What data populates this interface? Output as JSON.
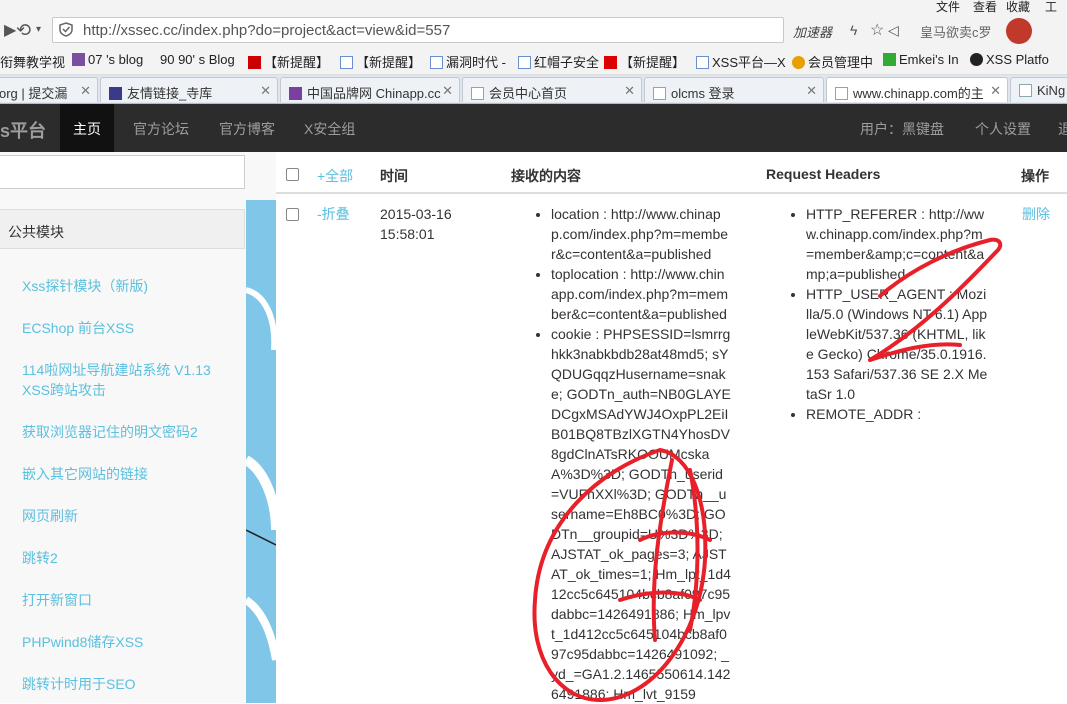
{
  "browser": {
    "menu": {
      "file": "文件",
      "view": "查看",
      "favorites": "收藏",
      "tools": "工具"
    },
    "url": "http://xssec.cc/index.php?do=project&act=view&id=557",
    "accelerator": "加速器",
    "user_label": "皇马欲卖c罗"
  },
  "bookmarks": [
    {
      "label": "衔舞教学视",
      "icon_color": "#888"
    },
    {
      "label": "07 's blog",
      "icon_color": "#7b4fa0"
    },
    {
      "label": "90 90' s Blog",
      "icon_color": "#d00"
    },
    {
      "label": "【新提醒】",
      "icon_color": "#c00"
    },
    {
      "label": "【新提醒】",
      "icon_color": "#6a8fd0"
    },
    {
      "label": "漏洞时代 -",
      "icon_color": "#6a8fd0"
    },
    {
      "label": "红帽子安全",
      "icon_color": "#6a8fd0"
    },
    {
      "label": "【新提醒】",
      "icon_color": "#d00"
    },
    {
      "label": "XSS平台—X",
      "icon_color": "#6a8fd0"
    },
    {
      "label": "会员管理中",
      "icon_color": "#e8a000"
    },
    {
      "label": "Emkei's In",
      "icon_color": "#3a3"
    },
    {
      "label": "XSS Platfo",
      "icon_color": "#222"
    }
  ],
  "tabs": [
    {
      "label": "org | 提交漏"
    },
    {
      "label": "友情链接_寺库"
    },
    {
      "label": "中国品牌网 Chinapp.cc"
    },
    {
      "label": "会员中心首页"
    },
    {
      "label": "olcms 登录"
    },
    {
      "label": "www.chinapp.com的主"
    },
    {
      "label": "KiNg"
    }
  ],
  "nav": {
    "brand": "s平台",
    "items": [
      "主页",
      "官方论坛",
      "官方博客",
      "X安全组"
    ],
    "user": "用户：黑键盘",
    "settings": "个人设置",
    "logout": "退"
  },
  "sidebar": {
    "heading": "公共模块",
    "links": [
      "Xss探针模块（新版)",
      "ECShop 前台XSS",
      "114啦网址导航建站系统 V1.13 XSS跨站攻击",
      "获取浏览器记住的明文密码2",
      "嵌入其它网站的链接",
      "网页刷新",
      "跳转2",
      "打开新窗口",
      "PHPwind8储存XSS",
      "跳转计时用于SEO"
    ]
  },
  "table": {
    "headers": {
      "all": "+全部",
      "time": "时间",
      "content": "接收的内容",
      "request_headers": "Request Headers",
      "actions": "操作"
    },
    "row": {
      "toggle": "-折叠",
      "time": "2015-03-16 15:58:01",
      "content": [
        "location : http://www.chinapp.com/index.php?m=member&c=content&a=published",
        "toplocation : http://www.chinapp.com/index.php?m=member&c=content&a=published",
        "cookie : PHPSESSID=lsmrrghkk3nabkbdb28at48md5; sYQDUGqqzHusername=snake; GODTn_auth=NB0GLAYEDCgxMSAdYWJ4OxpPL2EiIB01BQ8TBzlXGTN4YhosDV8gdClnATsRKOOUMcskaA%3D%3D; GODTn_userid=VUFnXXl%3D; GODTn__username=Eh8BC0%3D; GODTn__groupid=U%3D%3D; AJSTAT_ok_pages=3; AJSTAT_ok_times=1; Hm_lpt_1d412cc5c645104bcb8af097c95dabbc=1426491886; Hm_lpvt_1d412cc5c645104bcb8af097c95dabbc=1426491092; _yd_=GA1.2.1465550614.1426491886; Hm_lvt_9159"
      ],
      "headers": [
        "HTTP_REFERER : http://www.chinapp.com/index.php?m=member&amp;c=content&amp;a=published",
        "HTTP_USER_AGENT : Mozilla/5.0 (Windows NT 6.1) AppleWebKit/537.36 (KHTML, like Gecko) Chrome/35.0.1916.153 Safari/537.36 SE 2.X MetaSr 1.0",
        "REMOTE_ADDR :"
      ],
      "delete": "删除"
    }
  },
  "colors": {
    "link": "#5bc0de",
    "navbar": "#2c2c2c",
    "scribble": "#e8202a"
  }
}
